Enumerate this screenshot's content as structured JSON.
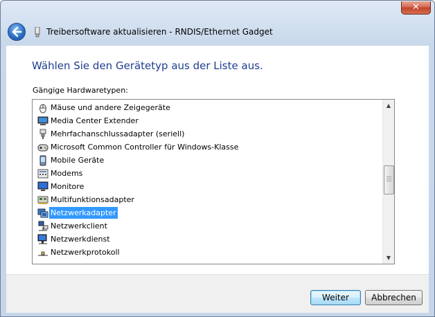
{
  "window": {
    "title": "Treibersoftware aktualisieren - RNDIS/Ethernet Gadget",
    "close_label": "✕"
  },
  "content": {
    "heading": "Wählen Sie den Gerätetyp aus der Liste aus.",
    "list_label": "Gängige Hardwaretypen:",
    "items": [
      {
        "label": "Mäuse und andere Zeigegeräte",
        "icon": "mouse-icon"
      },
      {
        "label": "Media Center Extender",
        "icon": "media-center-icon"
      },
      {
        "label": "Mehrfachanschlussadapter (seriell)",
        "icon": "serial-adapter-icon"
      },
      {
        "label": "Microsoft Common Controller für Windows-Klasse",
        "icon": "gamepad-icon"
      },
      {
        "label": "Mobile Geräte",
        "icon": "mobile-device-icon"
      },
      {
        "label": "Modems",
        "icon": "modem-icon"
      },
      {
        "label": "Monitore",
        "icon": "monitor-icon"
      },
      {
        "label": "Multifunktionsadapter",
        "icon": "multifunction-adapter-icon"
      },
      {
        "label": "Netzwerkadapter",
        "icon": "network-adapter-icon",
        "selected": true
      },
      {
        "label": "Netzwerkclient",
        "icon": "network-client-icon"
      },
      {
        "label": "Netzwerkdienst",
        "icon": "network-service-icon"
      },
      {
        "label": "Netzwerkprotokoll",
        "icon": "network-protocol-icon"
      }
    ]
  },
  "footer": {
    "next_label": "Weiter",
    "cancel_label": "Abbrechen"
  },
  "colors": {
    "heading": "#1e3d8f",
    "selection": "#3399ff"
  }
}
